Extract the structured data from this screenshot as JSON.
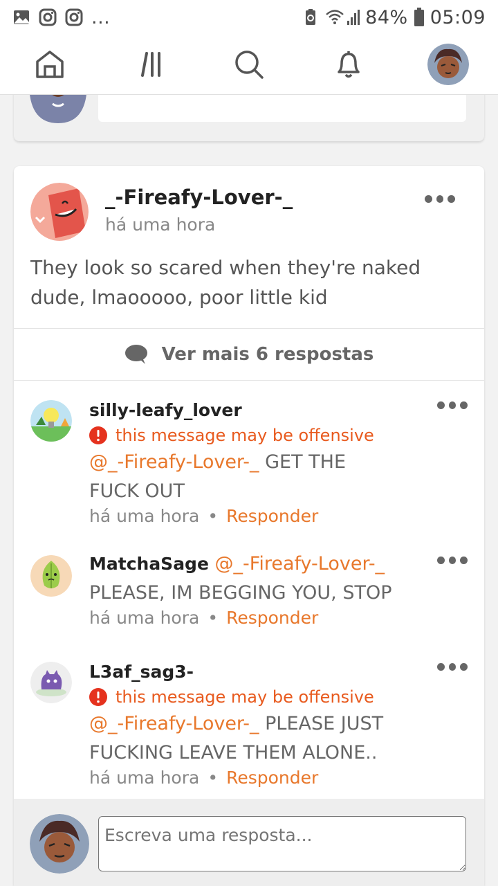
{
  "status_bar": {
    "left_icons": [
      "gallery-icon",
      "instagram-icon",
      "instagram-icon",
      "more-icon"
    ],
    "more_label": "...",
    "battery": "84%",
    "time": "05:09"
  },
  "nav": {
    "items": [
      "home-icon",
      "feed-icon",
      "search-icon",
      "bell-icon",
      "profile-avatar"
    ]
  },
  "post": {
    "username": "_-Fireafy-Lover-_",
    "time": "há uma hora",
    "body": "They look so scared when they're naked dude, lmaooooo, poor little kid"
  },
  "more_replies": "Ver mais 6 respostas",
  "comments": [
    {
      "username": "silly-leafy_lover",
      "warning": "this message may be offensive",
      "mention": "@_-Fireafy-Lover-_",
      "text": " GET THE FUCK OUT",
      "time": "há uma hora",
      "reply_label": "Responder"
    },
    {
      "username": "MatchaSage",
      "mention": "@_-Fireafy-Lover-_",
      "text": "PLEASE, IM BEGGING YOU, STOP",
      "time": "há uma hora",
      "reply_label": "Responder"
    },
    {
      "username": "L3af_sag3-",
      "warning": "this message may be offensive",
      "mention": "@_-Fireafy-Lover-_",
      "text": " PLEASE JUST FUCKING LEAVE THEM ALONE..",
      "time": "há uma hora",
      "reply_label": "Responder"
    }
  ],
  "reply_box": {
    "placeholder": "Escreva uma resposta..."
  },
  "colors": {
    "accent": "#e8782c",
    "warning": "#e85a1e",
    "text": "#222222",
    "muted": "#888888"
  }
}
